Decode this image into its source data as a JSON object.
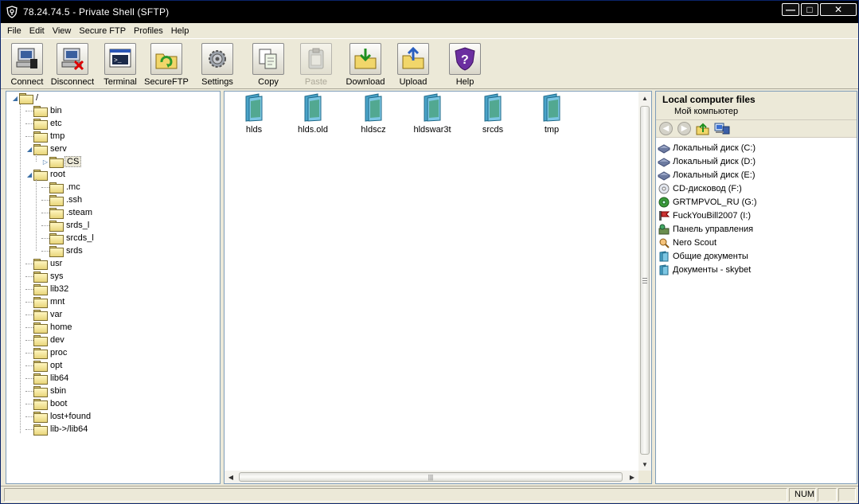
{
  "window": {
    "title": "78.24.74.5 - Private Shell (SFTP)"
  },
  "menu": [
    "File",
    "Edit",
    "View",
    "Secure FTP",
    "Profiles",
    "Help"
  ],
  "toolbar": [
    {
      "label": "Connect",
      "icon": "connect-icon",
      "enabled": true
    },
    {
      "label": "Disconnect",
      "icon": "disconnect-icon",
      "enabled": true
    },
    {
      "label": "Terminal",
      "icon": "terminal-icon",
      "enabled": true
    },
    {
      "label": "SecureFTP",
      "icon": "secureftp-icon",
      "enabled": true
    },
    {
      "label": "Settings",
      "icon": "gear-icon",
      "enabled": true
    },
    {
      "label": "Copy",
      "icon": "copy-icon",
      "enabled": true
    },
    {
      "label": "Paste",
      "icon": "paste-icon",
      "enabled": false
    },
    {
      "label": "Download",
      "icon": "download-icon",
      "enabled": true
    },
    {
      "label": "Upload",
      "icon": "upload-icon",
      "enabled": true
    },
    {
      "label": "Help",
      "icon": "help-shield-icon",
      "enabled": true
    }
  ],
  "tree": {
    "root": "/",
    "items": [
      {
        "label": "bin",
        "level": 1
      },
      {
        "label": "etc",
        "level": 1
      },
      {
        "label": "tmp",
        "level": 1
      },
      {
        "label": "serv",
        "level": 1,
        "expanded": true
      },
      {
        "label": "CS",
        "level": 2,
        "selected": true,
        "collapsed": true
      },
      {
        "label": "root",
        "level": 1,
        "expanded": true
      },
      {
        "label": ".mc",
        "level": 2
      },
      {
        "label": ".ssh",
        "level": 2
      },
      {
        "label": ".steam",
        "level": 2
      },
      {
        "label": "srds_l",
        "level": 2
      },
      {
        "label": "srcds_l",
        "level": 2
      },
      {
        "label": "srds",
        "level": 2
      },
      {
        "label": "usr",
        "level": 1
      },
      {
        "label": "sys",
        "level": 1
      },
      {
        "label": "lib32",
        "level": 1
      },
      {
        "label": "mnt",
        "level": 1
      },
      {
        "label": "var",
        "level": 1
      },
      {
        "label": "home",
        "level": 1
      },
      {
        "label": "dev",
        "level": 1
      },
      {
        "label": "proc",
        "level": 1
      },
      {
        "label": "opt",
        "level": 1
      },
      {
        "label": "lib64",
        "level": 1
      },
      {
        "label": "sbin",
        "level": 1
      },
      {
        "label": "boot",
        "level": 1
      },
      {
        "label": "lost+found",
        "level": 1
      },
      {
        "label": "lib->/lib64",
        "level": 1
      }
    ]
  },
  "files": [
    "hlds",
    "hlds.old",
    "hldscz",
    "hldswar3t",
    "srcds",
    "tmp"
  ],
  "local": {
    "title": "Local computer files",
    "subtitle": "Мой компьютер",
    "items": [
      {
        "label": "Локальный диск (C:)",
        "icon": "hard-drive-icon"
      },
      {
        "label": "Локальный диск (D:)",
        "icon": "hard-drive-icon"
      },
      {
        "label": "Локальный диск (E:)",
        "icon": "hard-drive-icon"
      },
      {
        "label": "CD-дисковод (F:)",
        "icon": "cd-drive-icon"
      },
      {
        "label": "GRTMPVOL_RU (G:)",
        "icon": "dvd-drive-icon"
      },
      {
        "label": "FuckYouBill2007 (I:)",
        "icon": "removable-drive-icon"
      },
      {
        "label": "Панель управления",
        "icon": "control-panel-icon"
      },
      {
        "label": "Nero Scout",
        "icon": "nero-scout-icon"
      },
      {
        "label": "Общие документы",
        "icon": "shared-folder-icon"
      },
      {
        "label": "Документы - skybet",
        "icon": "shared-folder-icon"
      }
    ]
  },
  "status": {
    "num": "NUM"
  }
}
